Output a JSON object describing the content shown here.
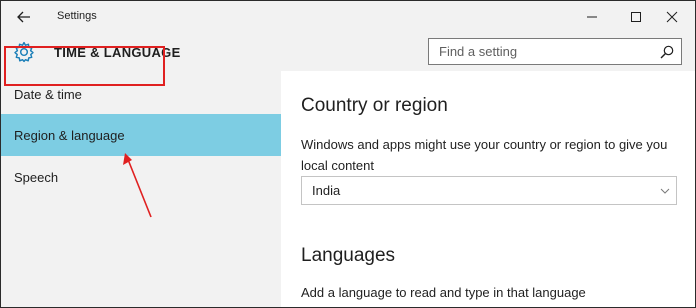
{
  "titlebar": {
    "app_title": "Settings",
    "back_icon": "back-arrow-icon",
    "minimize_icon": "minimize-icon",
    "maximize_icon": "maximize-icon",
    "close_icon": "close-icon"
  },
  "header": {
    "icon": "gear-icon",
    "title": "TIME & LANGUAGE",
    "search": {
      "placeholder": "Find a setting",
      "value": "",
      "icon": "search-icon"
    }
  },
  "sidebar": {
    "items": [
      {
        "label": "Date & time",
        "selected": false
      },
      {
        "label": "Region & language",
        "selected": true
      },
      {
        "label": "Speech",
        "selected": false
      }
    ],
    "selected_color": "#7dcde3"
  },
  "annotations": {
    "highlight_color": "#e02020",
    "highlight_target": "Region & language",
    "arrow_icon": "red-annotation-arrow"
  },
  "main": {
    "country_heading": "Country or region",
    "country_description": "Windows and apps might use your country or region to give you local content",
    "country_select": {
      "value": "India",
      "icon": "chevron-down-icon"
    },
    "languages_heading": "Languages",
    "languages_description": "Add a language to read and type in that language"
  }
}
